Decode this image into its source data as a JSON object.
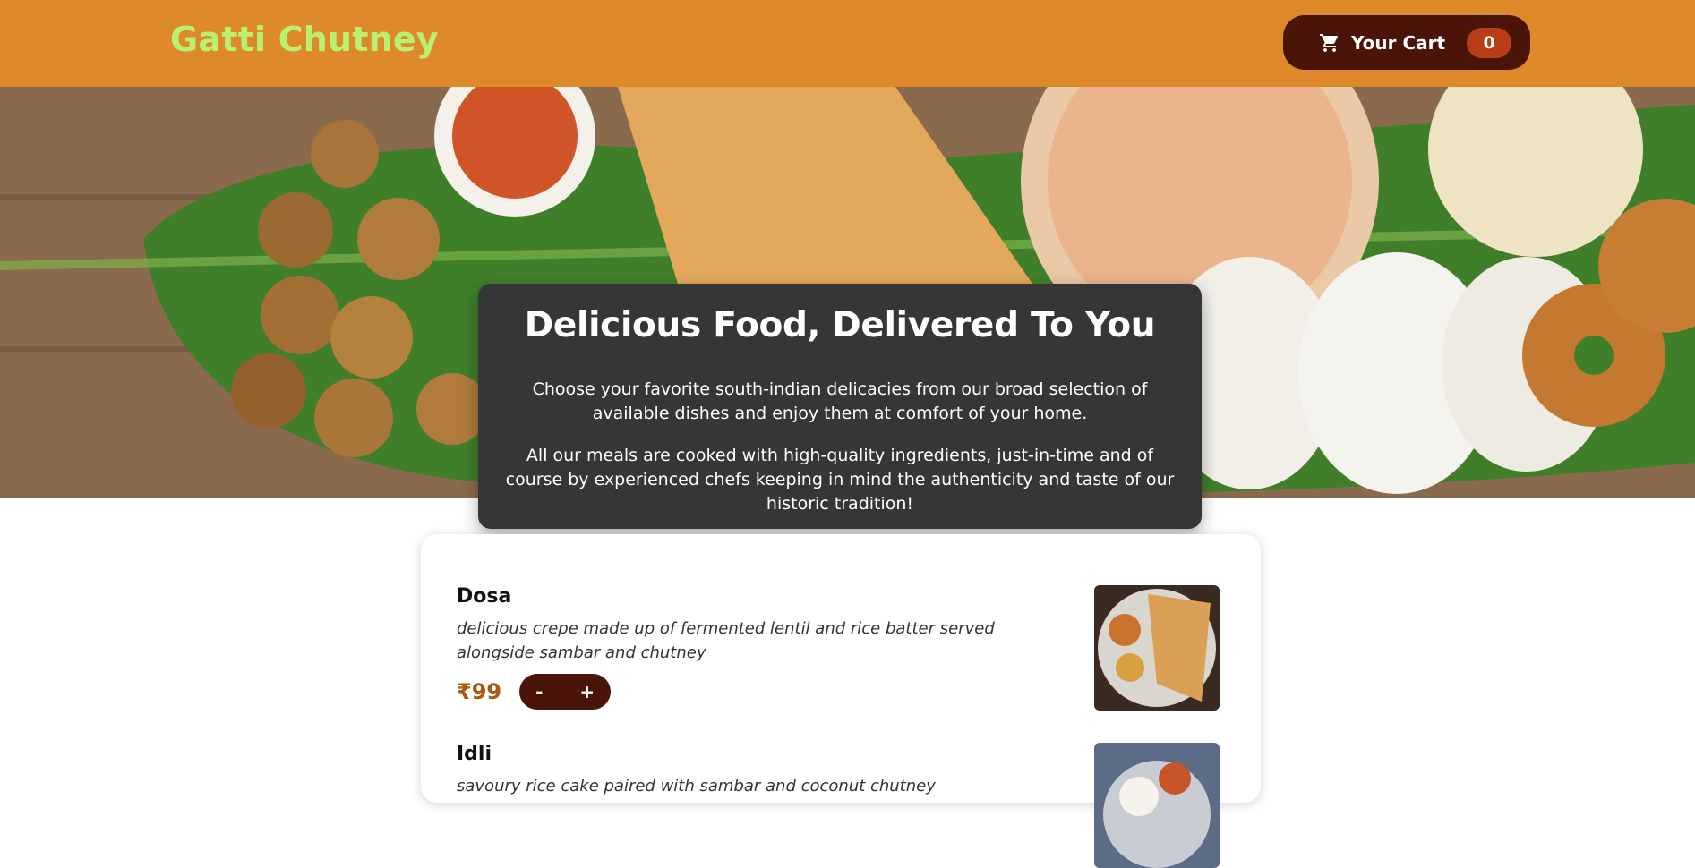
{
  "header": {
    "brand": "Gatti Chutney",
    "cart": {
      "label": "Your Cart",
      "count": "0",
      "icon": "cart-icon"
    }
  },
  "hero": {
    "title": "Delicious Food, Delivered To You",
    "paragraphs": [
      "Choose your favorite south-indian delicacies from our broad selection of available dishes and enjoy them at comfort of your home.",
      "All our meals are cooked with high-quality ingredients, just-in-time and of course by experienced chefs keeping in mind the authenticity and taste of our historic tradition!"
    ]
  },
  "menu": {
    "items": [
      {
        "name": "Dosa",
        "description": "delicious crepe made up of fermented lentil and rice batter served alongside sambar and chutney",
        "price": "₹99",
        "minus": "-",
        "plus": "+"
      },
      {
        "name": "Idli",
        "description": "savoury rice cake paired with sambar and coconut chutney"
      }
    ]
  },
  "colors": {
    "header_bg": "#de8a2b",
    "brand_text": "#b9f06f",
    "button_dark": "#4a1508",
    "badge_bg": "#b93e17",
    "hero_card": "#363636",
    "price_text": "#a85a12"
  }
}
